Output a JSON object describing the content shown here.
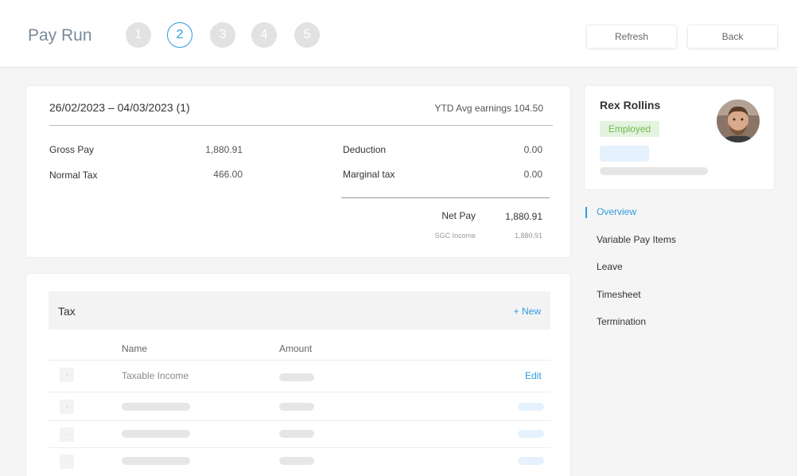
{
  "header": {
    "title": "Pay Run",
    "steps": [
      "1",
      "2",
      "3",
      "4",
      "5"
    ],
    "active_step": "2",
    "refresh_label": "Refresh",
    "back_label": "Back"
  },
  "summary": {
    "period": "26/02/2023 – 04/03/2023 (1)",
    "ytd": "YTD Avg earnings 104.50",
    "gross_pay_label": "Gross Pay",
    "gross_pay_value": "1,880.91",
    "normal_tax_label": "Normal Tax",
    "normal_tax_value": "466.00",
    "deduction_label": "Deduction",
    "deduction_value": "0.00",
    "marginal_tax_label": "Marginal tax",
    "marginal_tax_value": "0.00",
    "net_pay_label": "Net Pay",
    "net_pay_value": "1,880.91",
    "sgc_label": "SGC Income",
    "sgc_value": "1,880.91"
  },
  "tax": {
    "title": "Tax",
    "new_label": "+ New",
    "col_name": "Name",
    "col_amount": "Amount",
    "rows": [
      {
        "handle": "·",
        "name": "Taxable Income",
        "action": "Edit"
      },
      {
        "handle": "·"
      },
      {
        "handle": "·"
      },
      {
        "handle": "·"
      }
    ]
  },
  "employee": {
    "name": "Rex Rollins",
    "status": "Employed"
  },
  "nav": {
    "items": [
      "Overview",
      "Variable Pay Items",
      "Leave",
      "Timesheet",
      "Termination"
    ],
    "active": "Overview"
  },
  "colors": {
    "accent": "#2d9be0",
    "employed_badge_bg": "#e3f3df",
    "employed_badge_text": "#72b84a"
  },
  "icons": {
    "avatar": "employee-avatar-photo",
    "row_handle": "drag-handle-icon"
  }
}
